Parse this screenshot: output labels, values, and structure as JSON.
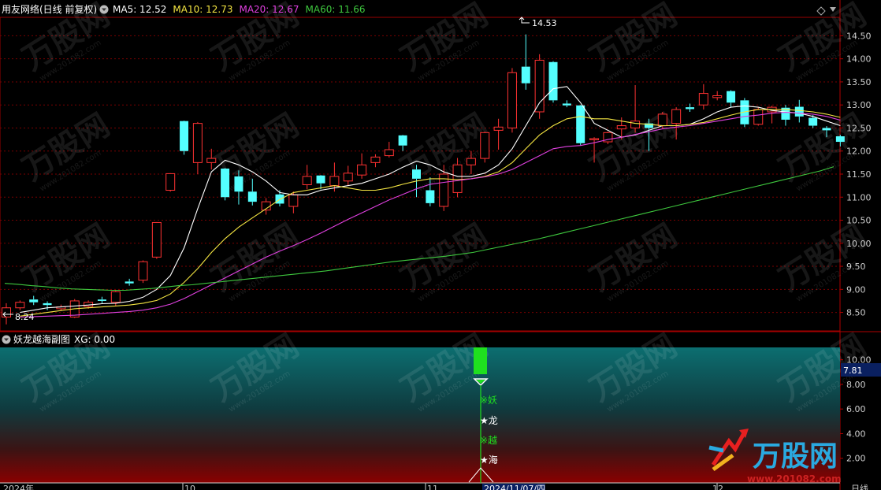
{
  "header": {
    "title": "用友网络(日线 前复权)",
    "ma_items": [
      {
        "label": "MA5: 12.52",
        "color": "#ffffff"
      },
      {
        "label": "MA10: 12.73",
        "color": "#f5e642"
      },
      {
        "label": "MA20: 12.67",
        "color": "#e040e0"
      },
      {
        "label": "MA60: 11.66",
        "color": "#3ec83e"
      }
    ]
  },
  "subchart": {
    "title": "妖龙越海副图",
    "xg_label": "XG: 0.00",
    "value_tag": "7.81",
    "signal_labels": [
      "※妖",
      "★龙",
      "※越",
      "★海"
    ],
    "y_ticks": [
      "10.00",
      "8.00",
      "6.00",
      "4.00",
      "2.00"
    ]
  },
  "x_axis": {
    "labels": [
      "2024年",
      "10",
      "11",
      "2024/11/07/四",
      "12",
      "日线"
    ]
  },
  "watermark": {
    "brand": "万股网",
    "url": "www.201082.com"
  },
  "colors": {
    "up": "#ff3232",
    "down": "#54ffff",
    "grid": "#7a0000",
    "axis": "#b00000"
  },
  "chart_data": {
    "type": "candlestick",
    "y_ticks": [
      "14.50",
      "14.00",
      "13.50",
      "13.00",
      "12.50",
      "12.00",
      "11.50",
      "11.00",
      "10.50",
      "10.00",
      "9.50",
      "9.00",
      "8.50"
    ],
    "ylim": [
      8.1,
      14.9
    ],
    "annotations": [
      {
        "label": "14.53"
      },
      {
        "label": "8.24"
      }
    ],
    "candles": [
      {
        "o": 8.4,
        "c": 8.6,
        "h": 8.7,
        "l": 8.24
      },
      {
        "o": 8.6,
        "c": 8.72,
        "h": 8.76,
        "l": 8.55
      },
      {
        "o": 8.78,
        "c": 8.72,
        "h": 8.86,
        "l": 8.66
      },
      {
        "o": 8.7,
        "c": 8.66,
        "h": 8.74,
        "l": 8.55
      },
      {
        "o": 8.58,
        "c": 8.62,
        "h": 8.67,
        "l": 8.53
      },
      {
        "o": 8.4,
        "c": 8.75,
        "h": 8.79,
        "l": 8.38
      },
      {
        "o": 8.63,
        "c": 8.72,
        "h": 8.76,
        "l": 8.58
      },
      {
        "o": 8.78,
        "c": 8.75,
        "h": 8.84,
        "l": 8.7
      },
      {
        "o": 8.72,
        "c": 8.95,
        "h": 8.98,
        "l": 8.64
      },
      {
        "o": 9.17,
        "c": 9.13,
        "h": 9.23,
        "l": 9.08
      },
      {
        "o": 9.2,
        "c": 9.6,
        "h": 9.63,
        "l": 9.14
      },
      {
        "o": 9.7,
        "c": 10.45,
        "h": 10.46,
        "l": 9.66
      },
      {
        "o": 11.15,
        "c": 11.51,
        "h": 11.52,
        "l": 11.12
      },
      {
        "o": 12.65,
        "c": 12.0,
        "h": 12.66,
        "l": 11.92
      },
      {
        "o": 11.75,
        "c": 12.6,
        "h": 12.63,
        "l": 11.5
      },
      {
        "o": 11.75,
        "c": 11.84,
        "h": 12.05,
        "l": 11.6
      },
      {
        "o": 11.62,
        "c": 11.0,
        "h": 11.63,
        "l": 10.93
      },
      {
        "o": 11.45,
        "c": 11.12,
        "h": 11.58,
        "l": 10.84
      },
      {
        "o": 11.12,
        "c": 10.9,
        "h": 11.4,
        "l": 10.82
      },
      {
        "o": 10.72,
        "c": 10.9,
        "h": 10.98,
        "l": 10.62
      },
      {
        "o": 11.06,
        "c": 10.86,
        "h": 11.15,
        "l": 10.8
      },
      {
        "o": 10.8,
        "c": 11.05,
        "h": 11.12,
        "l": 10.65
      },
      {
        "o": 11.27,
        "c": 11.45,
        "h": 11.7,
        "l": 11.17
      },
      {
        "o": 11.47,
        "c": 11.3,
        "h": 11.48,
        "l": 11.17
      },
      {
        "o": 11.25,
        "c": 11.45,
        "h": 11.75,
        "l": 11.12
      },
      {
        "o": 11.35,
        "c": 11.52,
        "h": 11.68,
        "l": 11.26
      },
      {
        "o": 11.48,
        "c": 11.7,
        "h": 11.95,
        "l": 11.4
      },
      {
        "o": 11.75,
        "c": 11.87,
        "h": 11.93,
        "l": 11.65
      },
      {
        "o": 11.9,
        "c": 12.03,
        "h": 12.2,
        "l": 11.86
      },
      {
        "o": 12.34,
        "c": 12.12,
        "h": 12.35,
        "l": 12.0
      },
      {
        "o": 11.6,
        "c": 11.4,
        "h": 11.7,
        "l": 11.0
      },
      {
        "o": 11.15,
        "c": 10.87,
        "h": 11.43,
        "l": 10.8
      },
      {
        "o": 10.8,
        "c": 11.5,
        "h": 11.7,
        "l": 10.7
      },
      {
        "o": 11.1,
        "c": 11.7,
        "h": 11.85,
        "l": 11.0
      },
      {
        "o": 11.7,
        "c": 11.84,
        "h": 12.0,
        "l": 11.5
      },
      {
        "o": 11.84,
        "c": 12.4,
        "h": 12.42,
        "l": 11.75
      },
      {
        "o": 12.45,
        "c": 12.52,
        "h": 12.7,
        "l": 12.03
      },
      {
        "o": 12.5,
        "c": 13.7,
        "h": 13.8,
        "l": 12.4
      },
      {
        "o": 13.83,
        "c": 13.47,
        "h": 14.53,
        "l": 13.33
      },
      {
        "o": 12.85,
        "c": 13.97,
        "h": 14.1,
        "l": 12.7
      },
      {
        "o": 13.93,
        "c": 13.1,
        "h": 13.95,
        "l": 13.05
      },
      {
        "o": 13.03,
        "c": 12.99,
        "h": 13.1,
        "l": 12.95
      },
      {
        "o": 12.99,
        "c": 12.17,
        "h": 13.0,
        "l": 12.12
      },
      {
        "o": 12.27,
        "c": 12.27,
        "h": 12.3,
        "l": 11.75
      },
      {
        "o": 12.2,
        "c": 12.4,
        "h": 12.42,
        "l": 12.15
      },
      {
        "o": 12.48,
        "c": 12.55,
        "h": 12.73,
        "l": 12.25
      },
      {
        "o": 12.5,
        "c": 12.65,
        "h": 13.43,
        "l": 12.4
      },
      {
        "o": 12.6,
        "c": 12.5,
        "h": 12.7,
        "l": 12.0
      },
      {
        "o": 12.55,
        "c": 12.8,
        "h": 12.85,
        "l": 12.5
      },
      {
        "o": 12.6,
        "c": 12.9,
        "h": 12.95,
        "l": 12.25
      },
      {
        "o": 12.95,
        "c": 12.91,
        "h": 13.03,
        "l": 12.85
      },
      {
        "o": 13.0,
        "c": 13.25,
        "h": 13.45,
        "l": 12.9
      },
      {
        "o": 13.16,
        "c": 13.2,
        "h": 13.3,
        "l": 13.1
      },
      {
        "o": 13.3,
        "c": 13.05,
        "h": 13.32,
        "l": 12.95
      },
      {
        "o": 13.1,
        "c": 12.58,
        "h": 13.15,
        "l": 12.52
      },
      {
        "o": 12.58,
        "c": 12.9,
        "h": 12.96,
        "l": 12.55
      },
      {
        "o": 12.85,
        "c": 12.95,
        "h": 12.98,
        "l": 12.6
      },
      {
        "o": 12.94,
        "c": 12.68,
        "h": 13.0,
        "l": 12.55
      },
      {
        "o": 12.96,
        "c": 12.75,
        "h": 13.11,
        "l": 12.62
      },
      {
        "o": 12.72,
        "c": 12.55,
        "h": 12.78,
        "l": 12.5
      },
      {
        "o": 12.5,
        "c": 12.45,
        "h": 12.54,
        "l": 12.3
      },
      {
        "o": 12.32,
        "c": 12.2,
        "h": 12.35,
        "l": 12.1
      }
    ],
    "ma_lines": {
      "ma5": [
        8.5,
        8.55,
        8.6,
        8.62,
        8.64,
        8.66,
        8.69,
        8.7,
        8.74,
        8.83,
        9.0,
        9.3,
        9.9,
        10.75,
        11.55,
        11.8,
        11.7,
        11.55,
        11.35,
        11.1,
        11.05,
        11.05,
        11.15,
        11.2,
        11.25,
        11.3,
        11.4,
        11.5,
        11.65,
        11.78,
        11.7,
        11.55,
        11.45,
        11.45,
        11.52,
        11.7,
        12.05,
        12.55,
        13.05,
        13.35,
        13.4,
        13.05,
        12.6,
        12.45,
        12.3,
        12.35,
        12.45,
        12.55,
        12.55,
        12.58,
        12.7,
        12.85,
        12.95,
        12.98,
        12.95,
        12.88,
        12.85,
        12.82,
        12.75,
        12.65,
        12.55
      ],
      "ma10": [
        8.42,
        8.46,
        8.5,
        8.54,
        8.58,
        8.6,
        8.62,
        8.64,
        8.66,
        8.7,
        8.76,
        8.9,
        9.15,
        9.45,
        9.8,
        10.1,
        10.35,
        10.55,
        10.75,
        10.95,
        11.1,
        11.15,
        11.2,
        11.25,
        11.2,
        11.15,
        11.15,
        11.2,
        11.28,
        11.35,
        11.4,
        11.4,
        11.38,
        11.4,
        11.45,
        11.55,
        11.75,
        12.05,
        12.35,
        12.55,
        12.7,
        12.75,
        12.7,
        12.7,
        12.65,
        12.6,
        12.58,
        12.55,
        12.55,
        12.58,
        12.62,
        12.7,
        12.78,
        12.85,
        12.9,
        12.9,
        12.9,
        12.88,
        12.85,
        12.8,
        12.73
      ],
      "ma20": [
        8.4,
        8.41,
        8.42,
        8.43,
        8.44,
        8.46,
        8.48,
        8.5,
        8.52,
        8.55,
        8.6,
        8.68,
        8.8,
        8.95,
        9.1,
        9.25,
        9.4,
        9.55,
        9.7,
        9.83,
        9.95,
        10.08,
        10.22,
        10.37,
        10.52,
        10.66,
        10.8,
        10.94,
        11.06,
        11.18,
        11.28,
        11.32,
        11.36,
        11.4,
        11.44,
        11.5,
        11.6,
        11.75,
        11.9,
        12.05,
        12.1,
        12.12,
        12.18,
        12.25,
        12.3,
        12.36,
        12.42,
        12.48,
        12.52,
        12.55,
        12.6,
        12.65,
        12.7,
        12.75,
        12.78,
        12.82,
        12.84,
        12.82,
        12.8,
        12.75,
        12.67
      ],
      "ma60": [
        9.13,
        9.11,
        9.08,
        9.06,
        9.03,
        9.01,
        9.0,
        8.99,
        8.98,
        8.98,
        9.0,
        9.02,
        9.05,
        9.08,
        9.1,
        9.13,
        9.16,
        9.19,
        9.22,
        9.25,
        9.28,
        9.31,
        9.34,
        9.37,
        9.4,
        9.44,
        9.48,
        9.52,
        9.56,
        9.6,
        9.63,
        9.66,
        9.69,
        9.72,
        9.76,
        9.8,
        9.86,
        9.92,
        9.98,
        10.04,
        10.1,
        10.17,
        10.24,
        10.31,
        10.38,
        10.45,
        10.52,
        10.59,
        10.66,
        10.73,
        10.8,
        10.87,
        10.94,
        11.01,
        11.08,
        11.15,
        11.22,
        11.29,
        11.36,
        11.43,
        11.5,
        11.57,
        11.66
      ]
    },
    "signal_index": 37,
    "subchart_ylim": [
      0,
      11
    ]
  }
}
